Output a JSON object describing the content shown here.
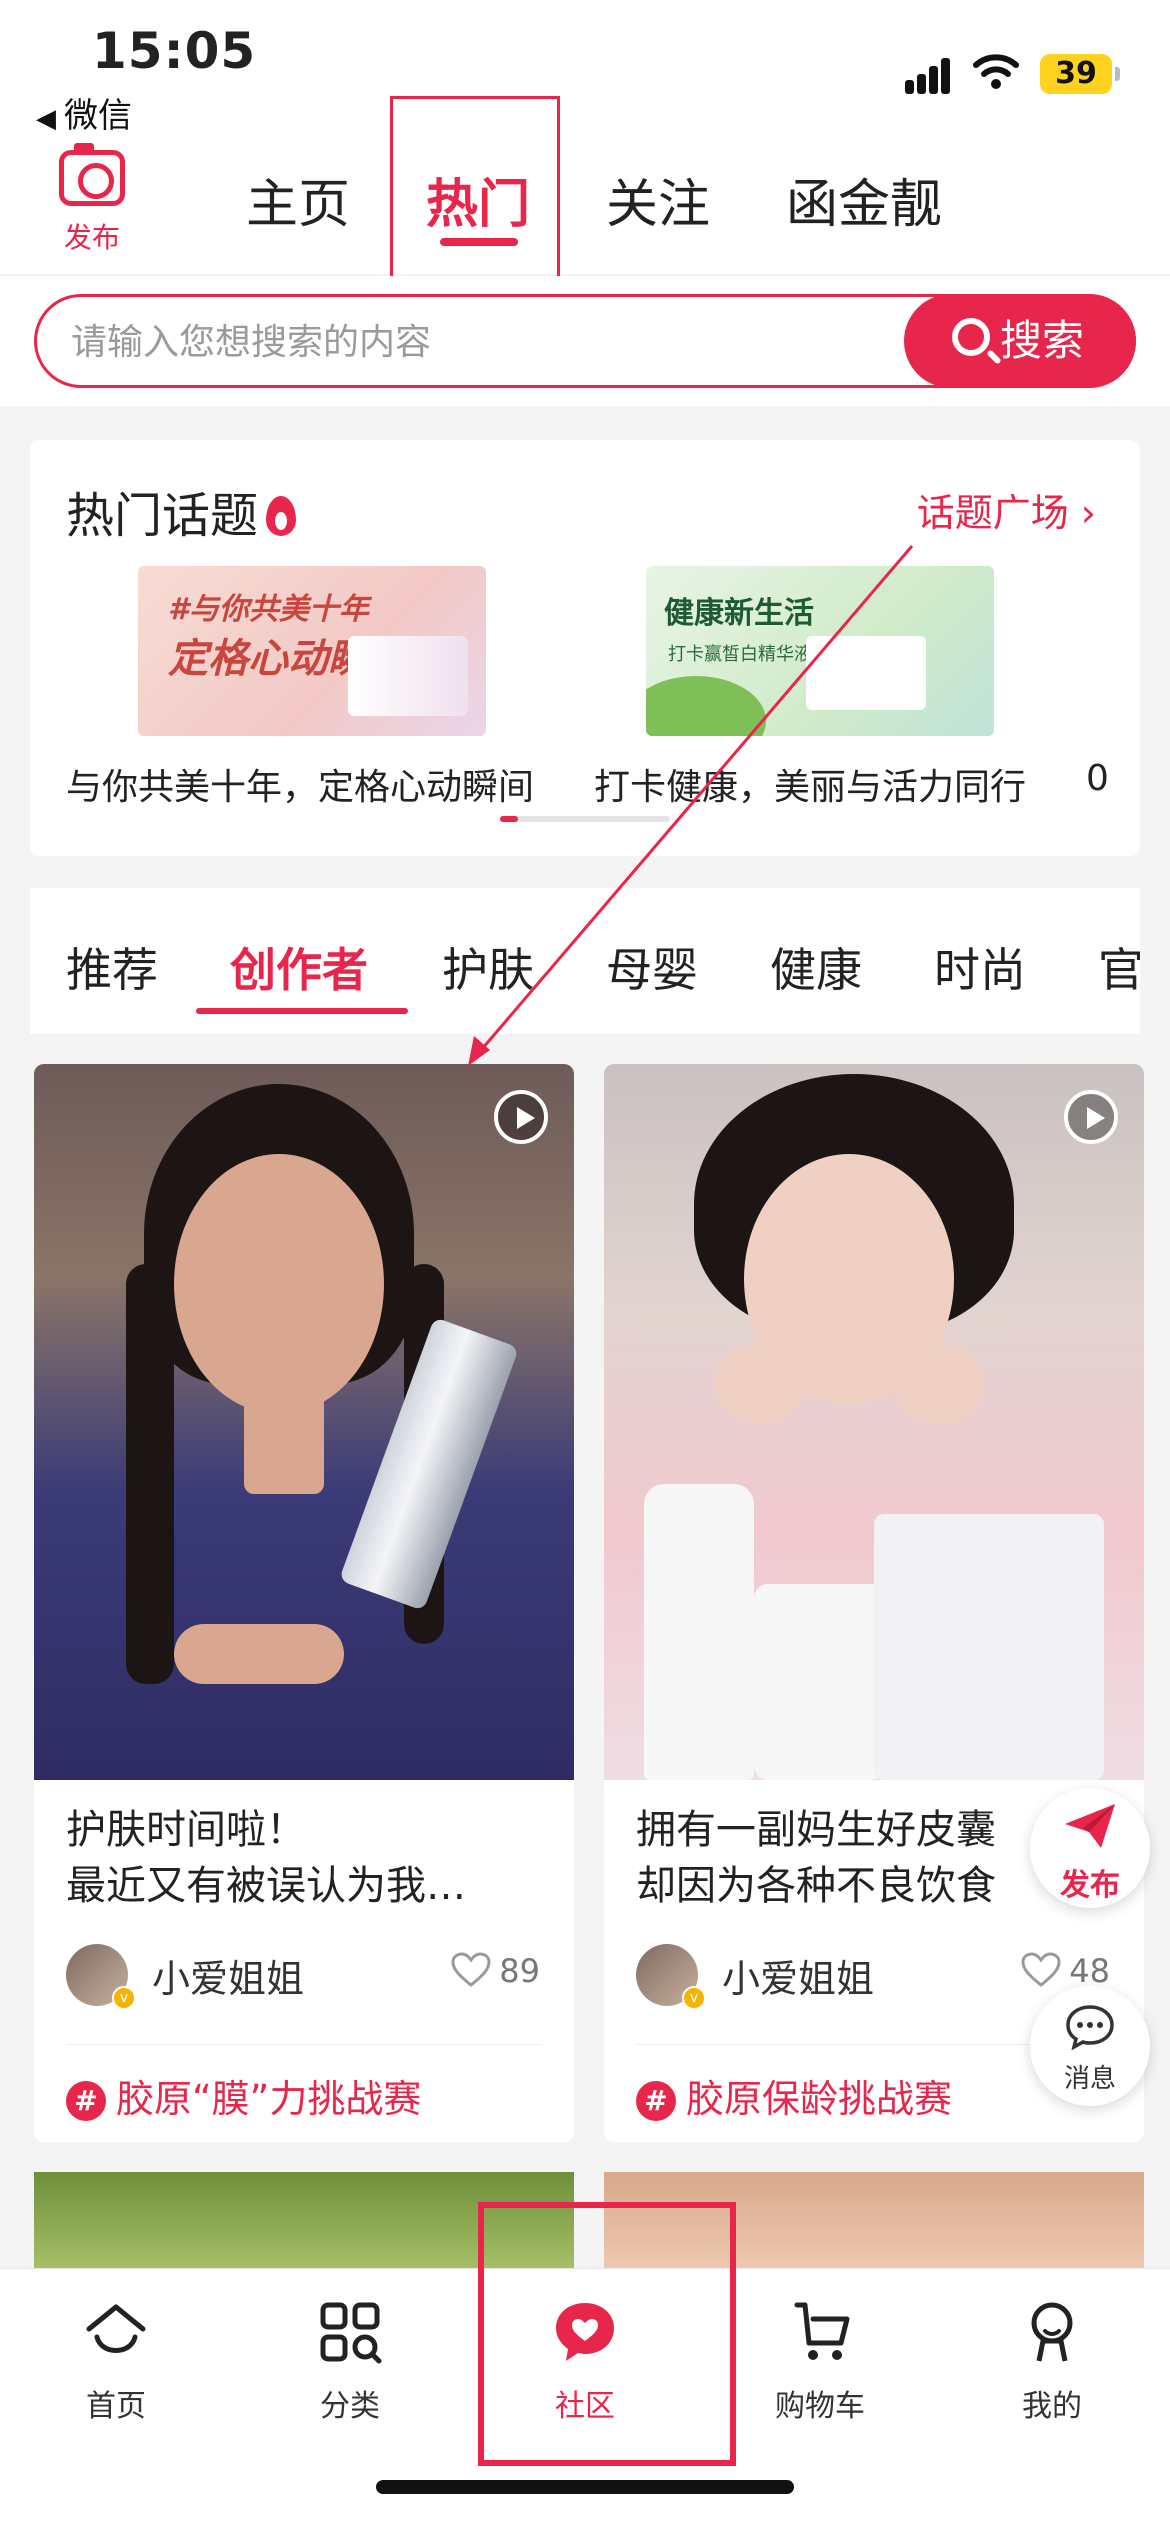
{
  "status_bar": {
    "time": "15:05",
    "back_label": "微信",
    "battery": "39"
  },
  "top_nav": {
    "publish_label": "发布",
    "tabs": [
      {
        "label": "主页"
      },
      {
        "label": "热门"
      },
      {
        "label": "关注"
      },
      {
        "label": "函金靓"
      }
    ]
  },
  "search": {
    "placeholder": "请输入您想搜索的内容",
    "button_label": "搜索"
  },
  "hot_topics": {
    "title": "热门话题",
    "more_label": "话题广场",
    "items": [
      {
        "banner_line1": "#与你共美十年",
        "banner_line2": "定格心动瞬间",
        "caption": "与你共美十年，定格心动瞬间"
      },
      {
        "banner_line1": "健康新生活",
        "banner_line2": "打卡赢皙白精华液",
        "caption": "打卡健康，美丽与活力同行"
      },
      {
        "caption": "0"
      }
    ]
  },
  "categories": [
    {
      "label": "推荐"
    },
    {
      "label": "创作者"
    },
    {
      "label": "护肤"
    },
    {
      "label": "母婴"
    },
    {
      "label": "健康"
    },
    {
      "label": "时尚"
    },
    {
      "label": "官"
    }
  ],
  "posts": [
    {
      "line1": "护肤时间啦！",
      "line2": "最近又有被误认为我…",
      "author": "小爱姐姐",
      "likes": "89",
      "topic": "胶原“膜”力挑战赛"
    },
    {
      "line1": "拥有一副妈生好皮囊",
      "line2": "却因为各种不良饮食",
      "author": "小爱姐姐",
      "likes": "48",
      "topic": "胶原保龄挑战赛"
    }
  ],
  "floating": {
    "publish_label": "发布",
    "message_label": "消息"
  },
  "tab_bar": [
    {
      "label": "首页",
      "icon": "home-icon"
    },
    {
      "label": "分类",
      "icon": "category-icon"
    },
    {
      "label": "社区",
      "icon": "community-icon"
    },
    {
      "label": "购物车",
      "icon": "cart-icon"
    },
    {
      "label": "我的",
      "icon": "profile-icon"
    }
  ],
  "colors": {
    "accent": "#e8254a",
    "background": "#f4f4f4"
  }
}
